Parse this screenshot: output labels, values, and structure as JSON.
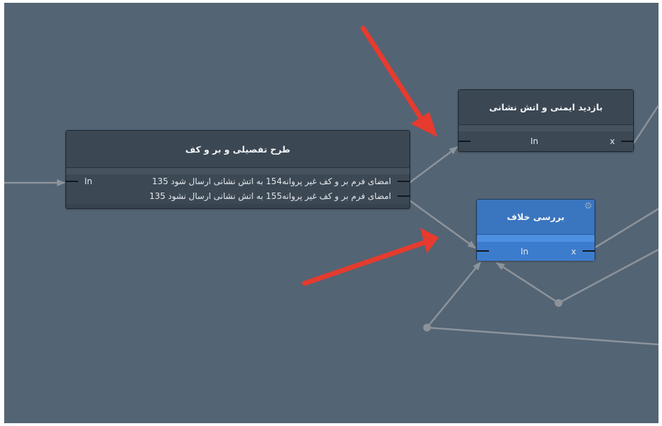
{
  "nodes": {
    "main": {
      "title": "طرح تفصیلی و بر و کف",
      "input_label": "In",
      "outputs": [
        {
          "label": "امضای فرم بر و کف غیر پروانه154 به اتش نشانی ارسال شود 135"
        },
        {
          "label": "امضای فرم بر و کف غیر پروانه155 به اتش نشانی ارسال نشود 135"
        }
      ]
    },
    "safety": {
      "title": "بازدید ایمنی و اتش نشانی",
      "input_label": "In",
      "output_label": "x"
    },
    "violation": {
      "title": "بررسی خلاف",
      "input_label": "In",
      "output_label": "x",
      "icon": "gear-icon"
    }
  },
  "colors": {
    "canvas": "#536474",
    "node_dark": "#37434f",
    "node_selected": "#3570b8",
    "wire": "#8c939b",
    "annotation_arrow": "#e63b2e"
  }
}
